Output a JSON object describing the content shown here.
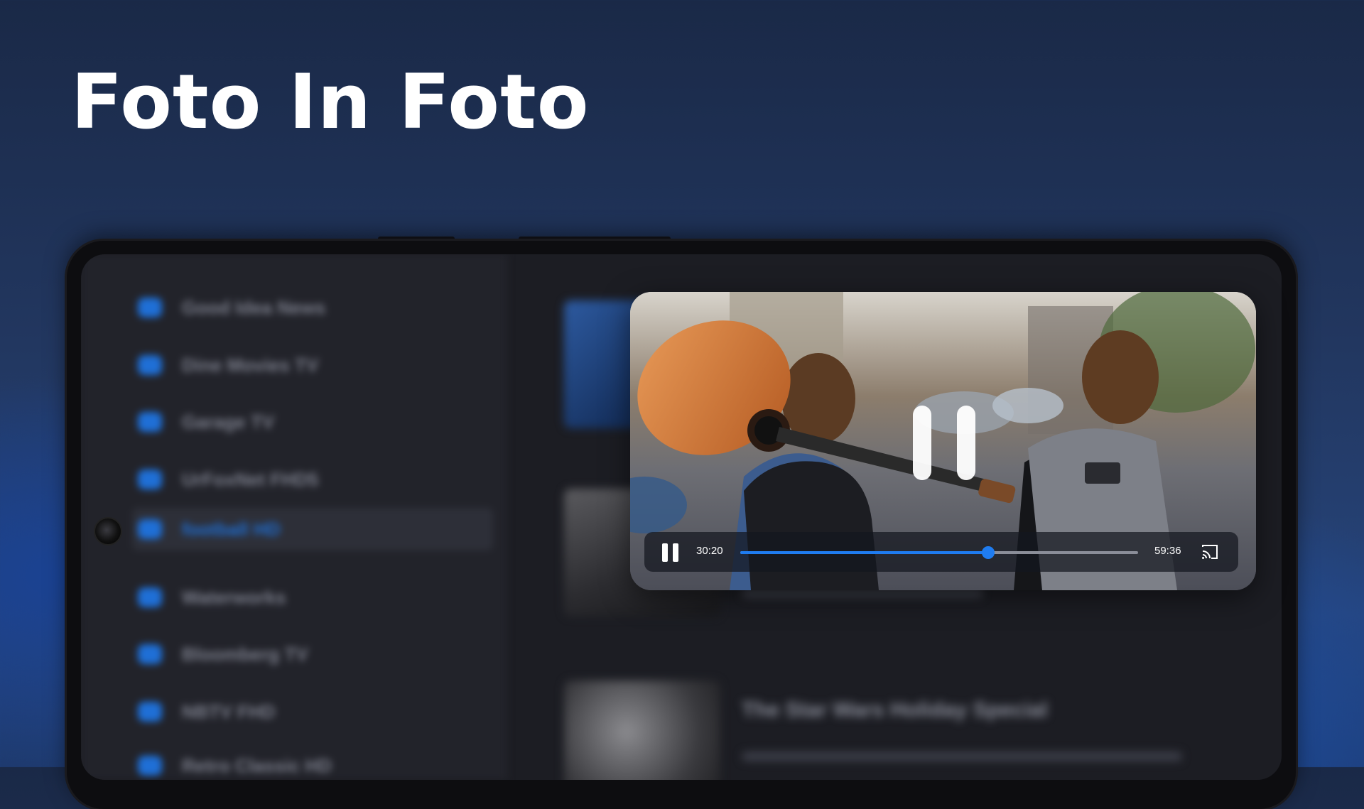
{
  "header": {
    "title": "Foto In Foto"
  },
  "sidebar": {
    "items": [
      {
        "label": "Good Idea News"
      },
      {
        "label": "Dine Movies TV"
      },
      {
        "label": "Garage TV"
      },
      {
        "label": "UrFoxNet FHD5"
      },
      {
        "label": "football HD"
      },
      {
        "label": "Waterworks"
      },
      {
        "label": "Bloomberg TV"
      },
      {
        "label": "NBTV FHD"
      },
      {
        "label": "Retro Classic HD"
      }
    ],
    "active_index": 4
  },
  "content": {
    "featured_title": "The Star Wars Holiday Special"
  },
  "player": {
    "current_time": "30:20",
    "total_time": "59:36",
    "progress": 0.623,
    "accent_color": "#1f7cf0"
  },
  "icons": {
    "big_pause": "pause-icon",
    "small_pause": "pause-icon",
    "cast": "cast-icon"
  }
}
